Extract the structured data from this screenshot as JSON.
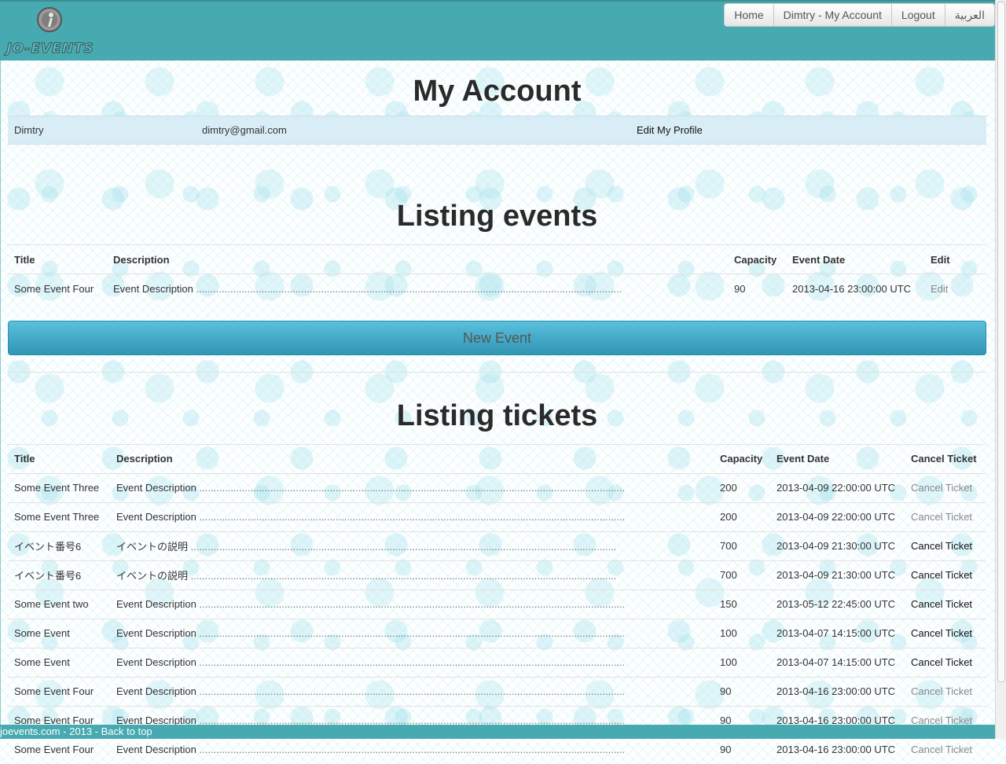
{
  "brand": {
    "logo_text": "JO-EVENTS"
  },
  "nav": [
    "Home",
    "Dimtry - My Account",
    "Logout",
    "العربية"
  ],
  "account": {
    "title": "My Account",
    "name": "Dimtry",
    "email": "dimtry@gmail.com",
    "edit_profile": "Edit My Profile"
  },
  "events": {
    "title": "Listing events",
    "headers": [
      "Title",
      "Description",
      "Capacity",
      "Event Date",
      "Edit"
    ],
    "rows": [
      {
        "title": "Some Event Four",
        "description": "Event Description",
        "capacity": "90",
        "date": "2013-04-16 23:00:00 UTC",
        "action": "Edit"
      }
    ]
  },
  "new_event_label": "New Event",
  "tickets": {
    "title": "Listing tickets",
    "headers": [
      "Title",
      "Description",
      "Capacity",
      "Event Date",
      "Cancel Ticket"
    ],
    "rows": [
      {
        "title": "Some Event Three",
        "description": "Event Description",
        "capacity": "200",
        "date": "2013-04-09 22:00:00 UTC",
        "action": "Cancel Ticket",
        "active": false
      },
      {
        "title": "Some Event Three",
        "description": "Event Description",
        "capacity": "200",
        "date": "2013-04-09 22:00:00 UTC",
        "action": "Cancel Ticket",
        "active": false
      },
      {
        "title": "イベント番号6",
        "description": "イベントの説明",
        "capacity": "700",
        "date": "2013-04-09 21:30:00 UTC",
        "action": "Cancel Ticket",
        "active": true
      },
      {
        "title": "イベント番号6",
        "description": "イベントの説明",
        "capacity": "700",
        "date": "2013-04-09 21:30:00 UTC",
        "action": "Cancel Ticket",
        "active": true
      },
      {
        "title": "Some Event two",
        "description": "Event Description",
        "capacity": "150",
        "date": "2013-05-12 22:45:00 UTC",
        "action": "Cancel Ticket",
        "active": true
      },
      {
        "title": "Some Event",
        "description": "Event Description",
        "capacity": "100",
        "date": "2013-04-07 14:15:00 UTC",
        "action": "Cancel Ticket",
        "active": true
      },
      {
        "title": "Some Event",
        "description": "Event Description",
        "capacity": "100",
        "date": "2013-04-07 14:15:00 UTC",
        "action": "Cancel Ticket",
        "active": true
      },
      {
        "title": "Some Event Four",
        "description": "Event Description",
        "capacity": "90",
        "date": "2013-04-16 23:00:00 UTC",
        "action": "Cancel Ticket",
        "active": false
      },
      {
        "title": "Some Event Four",
        "description": "Event Description",
        "capacity": "90",
        "date": "2013-04-16 23:00:00 UTC",
        "action": "Cancel Ticket",
        "active": false
      },
      {
        "title": "Some Event Four",
        "description": "Event Description",
        "capacity": "90",
        "date": "2013-04-16 23:00:00 UTC",
        "action": "Cancel Ticket",
        "active": false
      }
    ]
  },
  "footer": "joevents.com - 2013 - Back to top",
  "colors": {
    "header": "#47aab0",
    "button": "#5bc0de",
    "account_row": "#d9edf7"
  }
}
